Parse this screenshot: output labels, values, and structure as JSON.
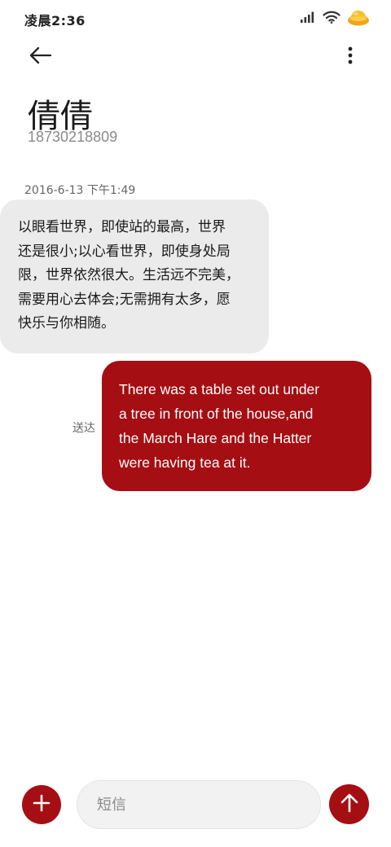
{
  "status_bar": {
    "time": "凌晨2:36",
    "icons": [
      "signal-icon",
      "wifi-icon",
      "gold-ingot-icon"
    ]
  },
  "header": {
    "back_icon": "back-arrow-icon",
    "more_icon": "more-vert-icon"
  },
  "contact": {
    "name": "倩倩",
    "number": "18730218809"
  },
  "conversation": {
    "timestamp": "2016-6-13 下午1:49",
    "incoming": {
      "lines": [
        "以眼看世界，即使站的最高，世界",
        "还是很小;以心看世界，即使身处局",
        "限，世界依然很大。生活远不完美，",
        "需要用心去体会;无需拥有太多，愿",
        "快乐与你相随。"
      ]
    },
    "outgoing": {
      "status": "送达",
      "lines": [
        "There was a table set out under",
        "a tree in front of the house,and",
        "the March Hare and the Hatter",
        "were having tea at it."
      ]
    }
  },
  "composer": {
    "placeholder": "短信",
    "add_icon": "plus-icon",
    "send_icon": "arrow-up-icon"
  },
  "colors": {
    "accent": "#a50e12",
    "incoming_bubble": "#ebebeb",
    "background": "#ffffff"
  }
}
